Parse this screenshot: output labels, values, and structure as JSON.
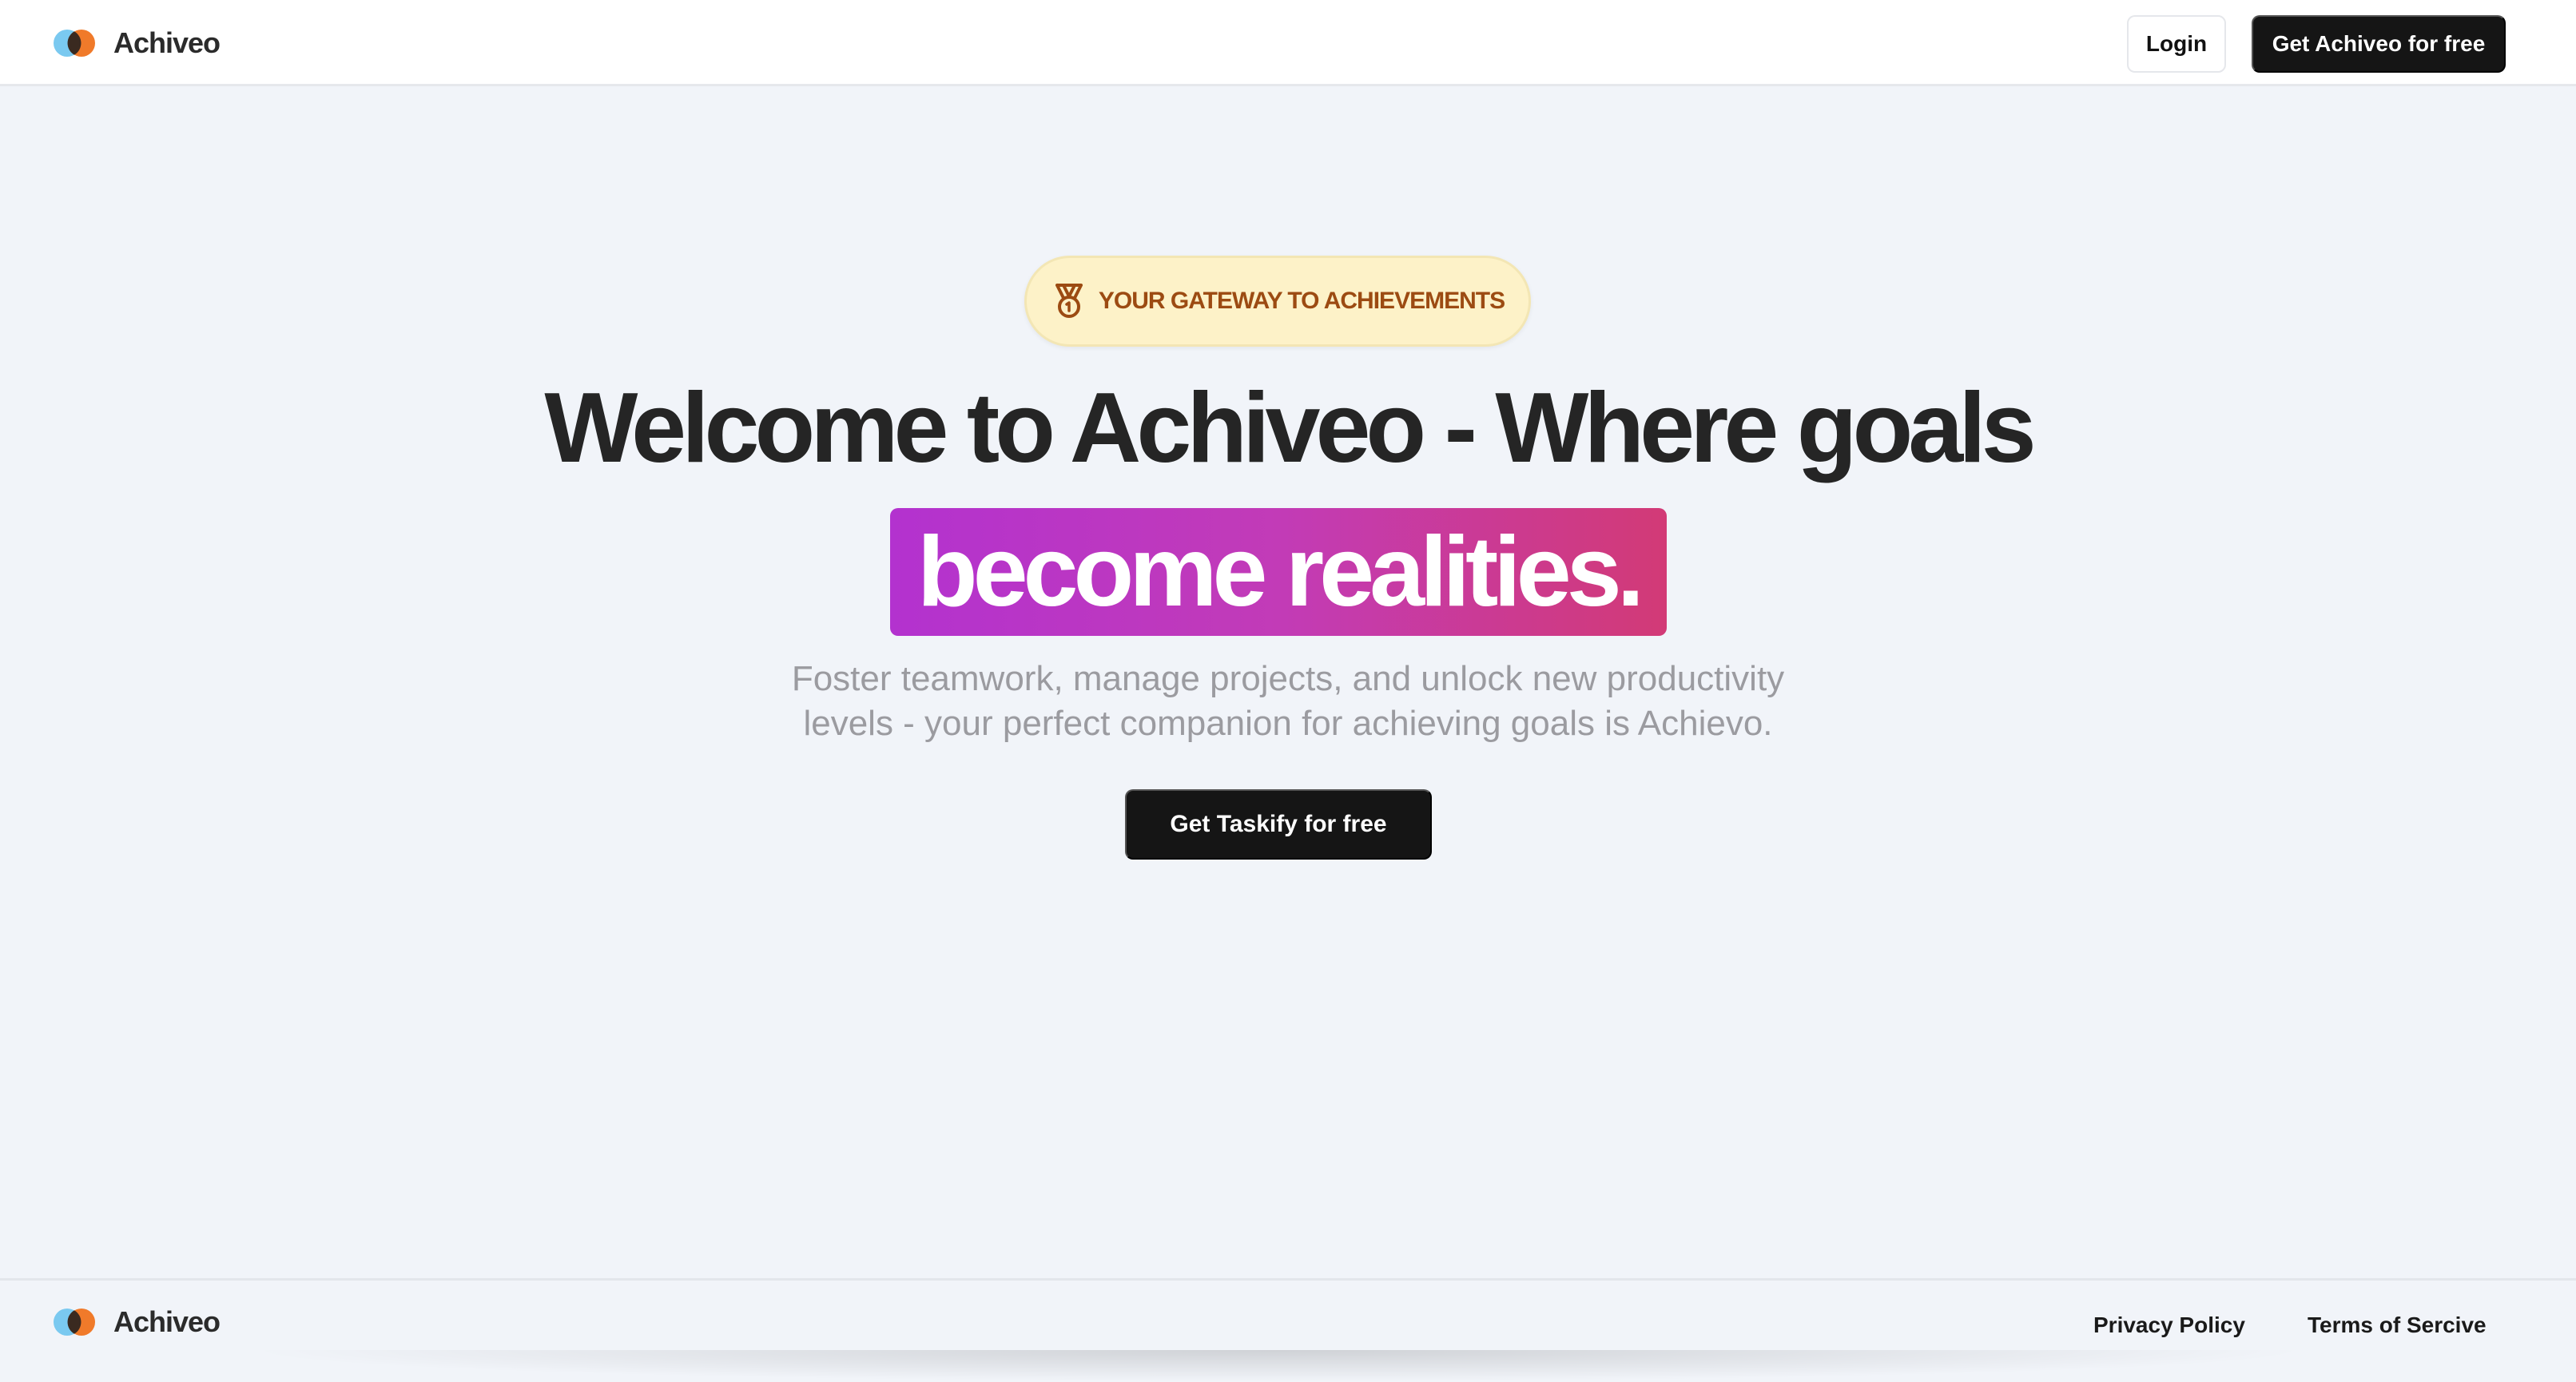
{
  "navbar": {
    "brand_name": "Achiveo",
    "login_label": "Login",
    "cta_label": "Get Achiveo for free"
  },
  "hero": {
    "badge_text": "YOUR GATEWAY TO ACHIEVEMENTS",
    "badge_icon": "medal-icon",
    "headline": "Welcome to Achiveo - Where goals",
    "highlight": "become realities.",
    "subtitle_line1": "Foster teamwork, manage projects, and unlock new productivity",
    "subtitle_line2": "levels - your perfect companion for achieving goals is Achievo.",
    "cta_label": "Get Taskify for free"
  },
  "footer": {
    "brand_name": "Achiveo",
    "privacy_label": "Privacy Policy",
    "terms_label": "Terms of Sercive"
  },
  "colors": {
    "background": "#f1f4f9",
    "dark_button": "#151515",
    "badge_bg": "#fdf2c8",
    "badge_text": "#9c4b12",
    "gradient_start": "#b332cf",
    "gradient_end": "#d23a76",
    "logo_blue": "#7ac9f0",
    "logo_orange": "#f07a2a"
  }
}
